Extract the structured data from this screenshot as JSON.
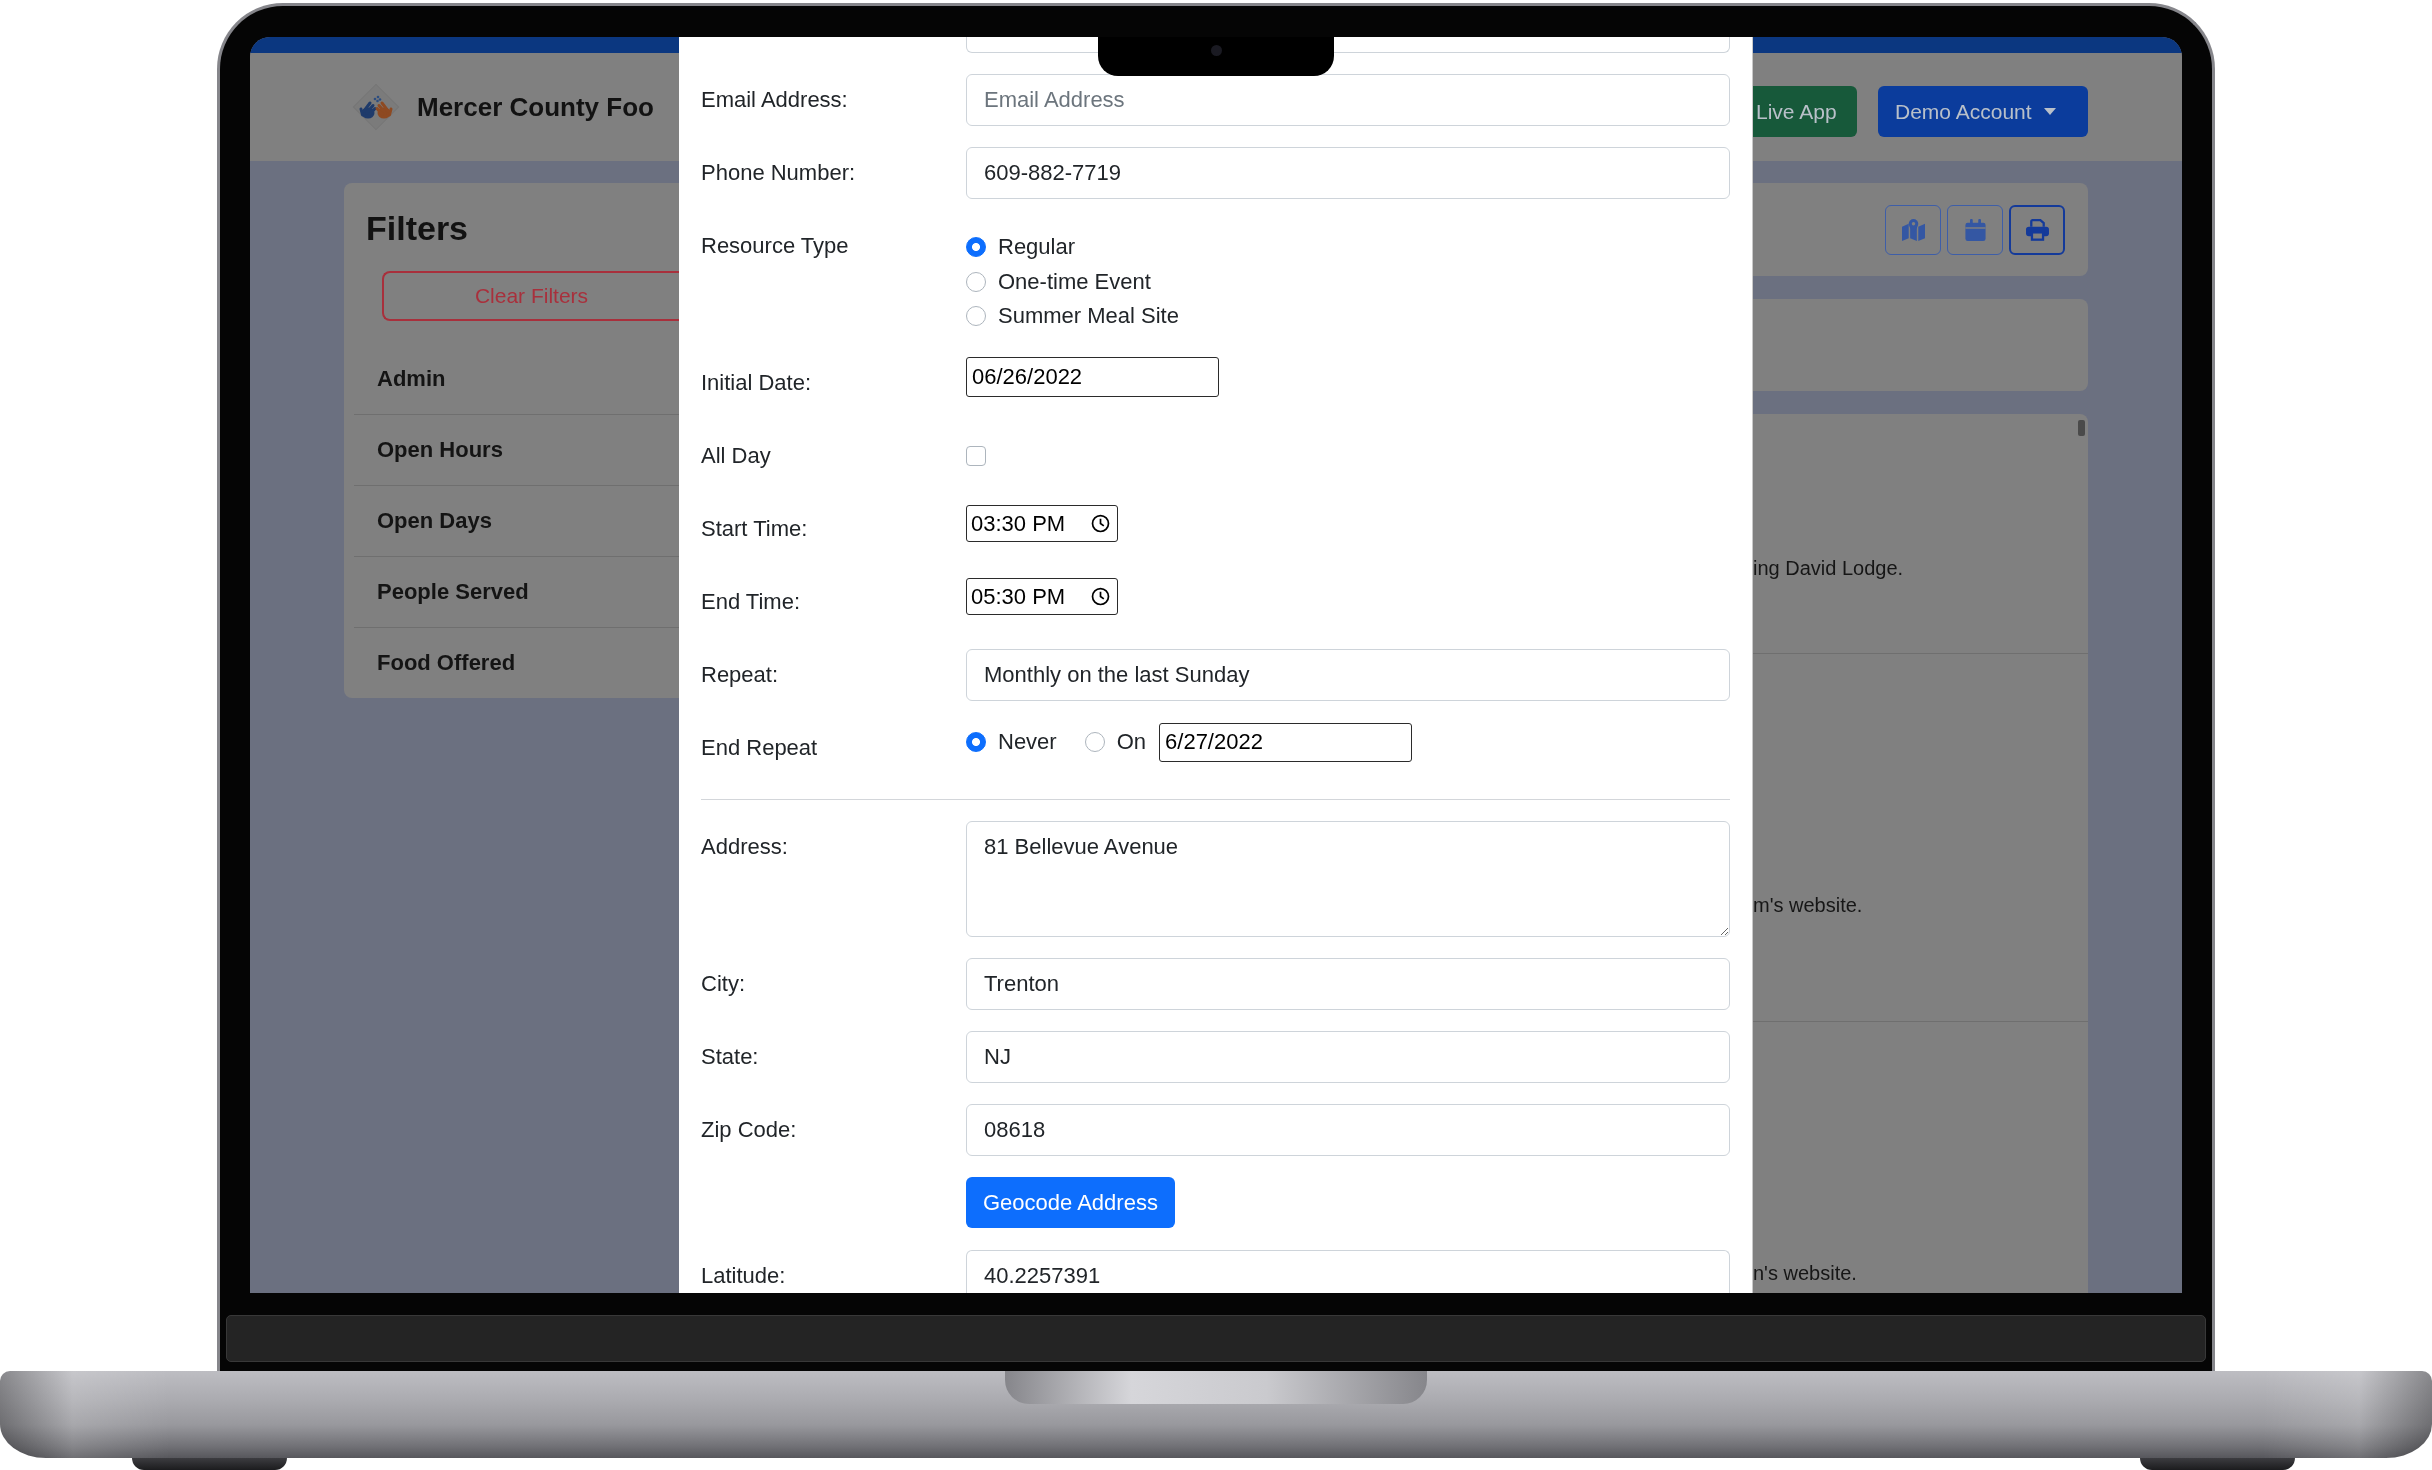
{
  "header": {
    "title": "Mercer County Foo",
    "buttons": [
      {
        "kind": "success",
        "label": "Live App"
      },
      {
        "kind": "dropdown",
        "label": "Demo Account"
      }
    ]
  },
  "filters": {
    "title": "Filters",
    "clear_button": "Clear Filters",
    "items": [
      "Admin",
      "Open Hours",
      "Open Days",
      "People Served",
      "Food Offered"
    ]
  },
  "toolbar": {
    "buttons": [
      {
        "focused": false
      },
      {
        "focused": false
      },
      {
        "focused": true
      }
    ]
  },
  "results": {
    "snippets": [
      "ing David Lodge.",
      "m's website.",
      "n's website."
    ]
  },
  "modal": {
    "fields": [
      {
        "kind": "text",
        "label": "Email Address:",
        "placeholder": "Email Address"
      },
      {
        "kind": "text",
        "label": "Phone Number:",
        "value": "609-882-7719"
      },
      {
        "kind": "radio",
        "label": "Resource Type",
        "options": [
          {
            "label": "Regular",
            "selected": true
          },
          {
            "label": "One-time Event",
            "selected": false
          },
          {
            "label": "Summer Meal Site",
            "selected": false
          }
        ]
      },
      {
        "kind": "date",
        "label": "Initial Date:",
        "value": "06/26/2022"
      },
      {
        "kind": "checkbox",
        "label": "All Day",
        "checked": false
      },
      {
        "kind": "time",
        "label": "Start Time:",
        "value": "03:30 PM"
      },
      {
        "kind": "time",
        "label": "End Time:",
        "value": "05:30 PM"
      },
      {
        "kind": "text",
        "label": "Repeat:",
        "value": "Monthly on the last Sunday"
      },
      {
        "kind": "end-repeat",
        "label": "End Repeat",
        "options": [
          {
            "label": "Never",
            "selected": true
          },
          {
            "label": "On",
            "selected": false
          }
        ],
        "date": "6/27/2022"
      },
      {
        "kind": "divider"
      },
      {
        "kind": "textarea",
        "label": "Address:",
        "value": "81 Bellevue Avenue"
      },
      {
        "kind": "text",
        "label": "City:",
        "value": "Trenton"
      },
      {
        "kind": "text",
        "label": "State:",
        "value": "NJ"
      },
      {
        "kind": "text",
        "label": "Zip Code:",
        "value": "08618"
      },
      {
        "kind": "button",
        "label": "Geocode Address"
      },
      {
        "kind": "text",
        "label": "Latitude:",
        "value": "40.2257391"
      }
    ]
  }
}
